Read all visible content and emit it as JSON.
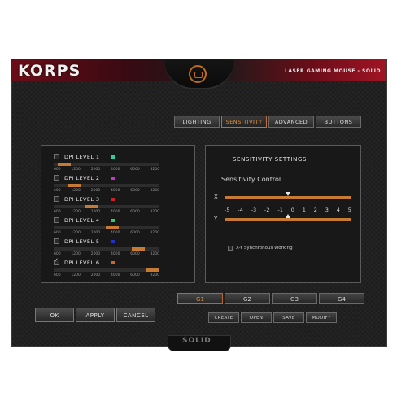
{
  "window": {
    "logo": "KORPS",
    "product": "LASER GAMING MOUSE - SOLID",
    "bottom_logo": "SOLID"
  },
  "colors": {
    "accent": "#c77a34",
    "background": "#1c1c1c"
  },
  "main_tabs": [
    {
      "label": "LIGHTING",
      "active": false
    },
    {
      "label": "SENSITIVITY",
      "active": true
    },
    {
      "label": "ADVANCED",
      "active": false
    },
    {
      "label": "BUTTONS",
      "active": false
    }
  ],
  "dpi_levels": [
    {
      "label": "DPI LEVEL 1",
      "checked": false,
      "color": "#33cc99",
      "value_fraction": 0.1
    },
    {
      "label": "DPI LEVEL 2",
      "checked": false,
      "color": "#cc33cc",
      "value_fraction": 0.2
    },
    {
      "label": "DPI LEVEL 3",
      "checked": false,
      "color": "#cc2222",
      "value_fraction": 0.35
    },
    {
      "label": "DPI LEVEL 4",
      "checked": false,
      "color": "#33cc66",
      "value_fraction": 0.55
    },
    {
      "label": "DPI LEVEL 5",
      "checked": false,
      "color": "#2233cc",
      "value_fraction": 0.8
    },
    {
      "label": "DPI LEVEL 6",
      "checked": true,
      "color": "#cc6622",
      "value_fraction": 0.97
    }
  ],
  "dpi_ticks": [
    "600",
    "1200",
    "2000",
    "4000",
    "6000",
    "8200"
  ],
  "sensitivity": {
    "title": "SENSITIVITY SETTINGS",
    "subtitle": "Sensitivity Control",
    "x_label": "X",
    "y_label": "Y",
    "x_value": 0,
    "y_value": 0,
    "scale": [
      "-5",
      "-4",
      "-3",
      "-2",
      "-1",
      "0",
      "1",
      "2",
      "3",
      "4",
      "5"
    ],
    "sync_label": "X-Y Synchronous Working",
    "sync_checked": false
  },
  "profiles": [
    {
      "label": "G1",
      "active": true
    },
    {
      "label": "G2",
      "active": false
    },
    {
      "label": "G3",
      "active": false
    },
    {
      "label": "G4",
      "active": false
    }
  ],
  "profile_actions": [
    "CREATE",
    "OPEN",
    "SAVE",
    "MODIFY"
  ],
  "actions": {
    "ok": "OK",
    "apply": "APPLY",
    "cancel": "CANCEL"
  }
}
